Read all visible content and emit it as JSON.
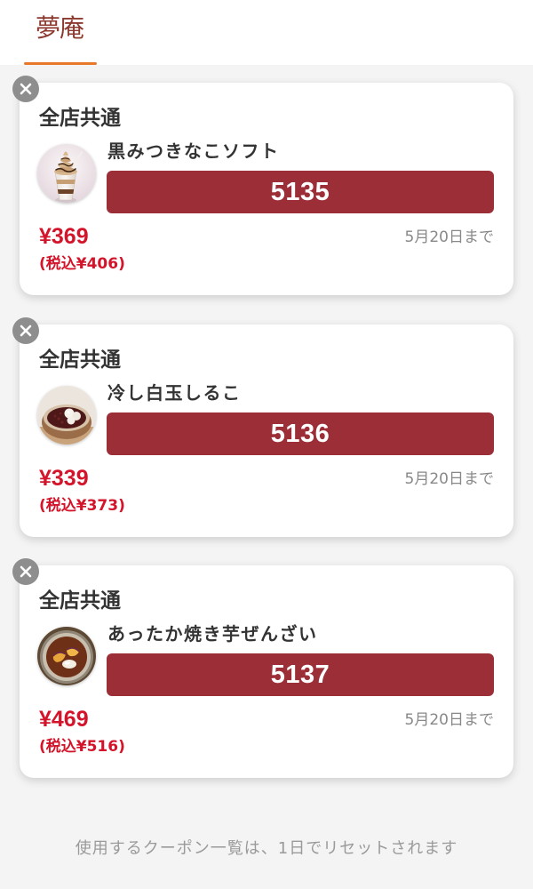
{
  "header": {
    "logo_text": "夢庵"
  },
  "coupons": [
    {
      "scope": "全店共通",
      "name": "黒みつきなこソフト",
      "code": "5135",
      "price": "¥369",
      "price_with_tax": "(税込¥406)",
      "expiry": "5月20日まで",
      "image_icon": "kuromitsu-kinako-soft-image"
    },
    {
      "scope": "全店共通",
      "name": "冷し白玉しるこ",
      "code": "5136",
      "price": "¥339",
      "price_with_tax": "(税込¥373)",
      "expiry": "5月20日まで",
      "image_icon": "hiyashi-shiratama-shiruko-image"
    },
    {
      "scope": "全店共通",
      "name": "あったか焼き芋ぜんざい",
      "code": "5137",
      "price": "¥469",
      "price_with_tax": "(税込¥516)",
      "expiry": "5月20日まで",
      "image_icon": "yakiimo-zenzai-image"
    }
  ],
  "footer": {
    "note": "使用するクーポン一覧は、1日でリセットされます"
  },
  "colors": {
    "tab_indicator": "#e8782a",
    "logo": "#8c3a2f",
    "code_bar": "#9c2e37",
    "price": "#d3142a",
    "close_button": "#8e8e8e",
    "page_background": "#f4f4f4",
    "card_background": "#ffffff"
  }
}
